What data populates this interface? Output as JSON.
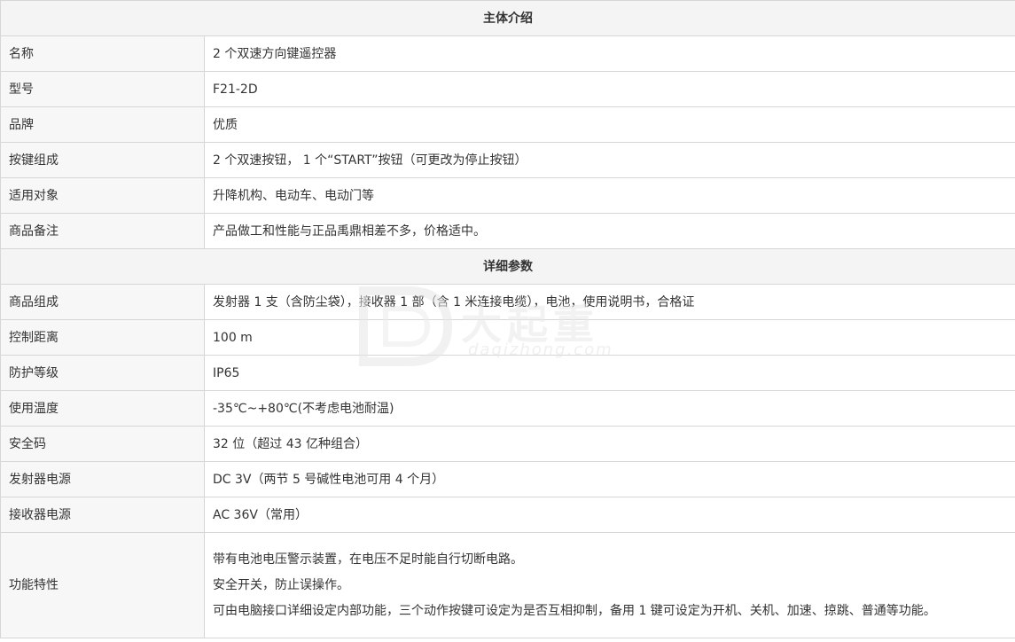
{
  "sections": {
    "intro_title": "主体介绍",
    "params_title": "详细参数"
  },
  "intro": [
    {
      "label": "名称",
      "value": "2 个双速方向键遥控器"
    },
    {
      "label": "型号",
      "value": "F21-2D"
    },
    {
      "label": "品牌",
      "value": "优质"
    },
    {
      "label": "按键组成",
      "value": "2 个双速按钮， 1 个“START”按钮（可更改为停止按钮）"
    },
    {
      "label": "适用对象",
      "value": "升降机构、电动车、电动门等"
    },
    {
      "label": "商品备注",
      "value": "产品做工和性能与正品禹鼎相差不多，价格适中。"
    }
  ],
  "params": [
    {
      "label": "商品组成",
      "value": "发射器 1 支（含防尘袋），接收器 1 部（含 1 米连接电缆），电池，使用说明书，合格证"
    },
    {
      "label": "控制距离",
      "value": "100 m"
    },
    {
      "label": "防护等级",
      "value": "IP65"
    },
    {
      "label": "使用温度",
      "value": "-35℃~+80℃(不考虑电池耐温)"
    },
    {
      "label": "安全码",
      "value": "32 位（超过 43 亿种组合）"
    },
    {
      "label": "发射器电源",
      "value": "DC 3V（两节 5 号碱性电池可用 4 个月）"
    },
    {
      "label": "接收器电源",
      "value": "AC 36V（常用）"
    }
  ],
  "features": {
    "label": "功能特性",
    "lines": [
      "带有电池电压警示装置，在电压不足时能自行切断电路。",
      "安全开关，防止误操作。",
      "可由电脑接口详细设定内部功能，三个动作按键可设定为是否互相抑制，备用 1 键可设定为开机、关机、加速、掠跳、普通等功能。"
    ]
  },
  "watermark": {
    "cn": "大起重",
    "en": "daqizhong.com"
  }
}
